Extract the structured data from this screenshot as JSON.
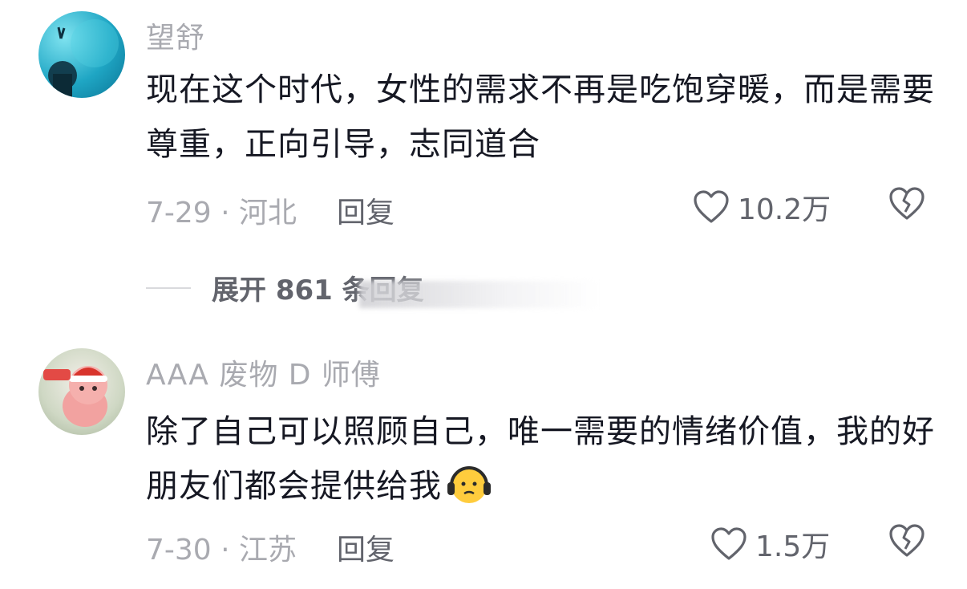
{
  "comments": [
    {
      "username": "望舒",
      "text": "现在这个时代，女性的需求不再是吃饱穿暖，而是需要尊重，正向引导，志同道合",
      "meta": "7-29 · 河北",
      "reply_label": "回复",
      "likes": "10.2万",
      "avatar_icon": "avatar-photo"
    },
    {
      "username": "AAA 废物 D 师傅",
      "text": "除了自己可以照顾自己，唯一需要的情绪价值，我的好朋友们都会提供给我",
      "meta": "7-30 · 江苏",
      "reply_label": "回复",
      "likes": "1.5万",
      "avatar_icon": "avatar-cartoon"
    }
  ],
  "expand": {
    "label": "展开 861 条回复"
  },
  "icons": {
    "like": "heart-outline-icon",
    "dislike": "broken-heart-icon",
    "emoji": "headphone-face-emoji"
  }
}
